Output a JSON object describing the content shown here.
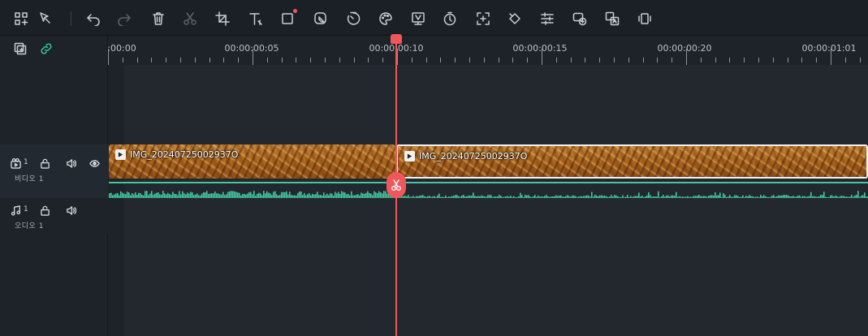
{
  "toolbar": {
    "tools": [
      {
        "name": "layout-icon"
      },
      {
        "name": "select-tool-icon"
      },
      {
        "name": "undo-icon"
      },
      {
        "name": "redo-icon"
      },
      {
        "name": "delete-icon"
      },
      {
        "name": "cut-icon"
      },
      {
        "name": "crop-icon"
      },
      {
        "name": "text-icon"
      },
      {
        "name": "shape-icon"
      },
      {
        "name": "mask-icon"
      },
      {
        "name": "speed-icon"
      },
      {
        "name": "color-palette-icon"
      },
      {
        "name": "ai-tool-icon"
      },
      {
        "name": "timer-icon"
      },
      {
        "name": "zoom-frame-icon"
      },
      {
        "name": "keyframe-icon"
      },
      {
        "name": "adjust-icon"
      },
      {
        "name": "speech-to-text-icon"
      },
      {
        "name": "translate-icon"
      },
      {
        "name": "auto-reframe-icon"
      }
    ]
  },
  "ruler": {
    "labels": [
      ":00:00",
      "00:00:00:05",
      "00:00:00:10",
      "00:00:00:15",
      "00:00:00:20",
      "00:00:01:01"
    ]
  },
  "tracks": {
    "video": {
      "number": "1",
      "name": "비디오 1"
    },
    "audio": {
      "number": "1",
      "name": "오디오 1"
    }
  },
  "clips": [
    {
      "title": "IMG_20240725002937O"
    },
    {
      "title": "IMG_20240725002937O"
    }
  ],
  "colors": {
    "accent": "#35c7a5",
    "playhead": "#f0575b",
    "waveform": "#43c7a3"
  }
}
